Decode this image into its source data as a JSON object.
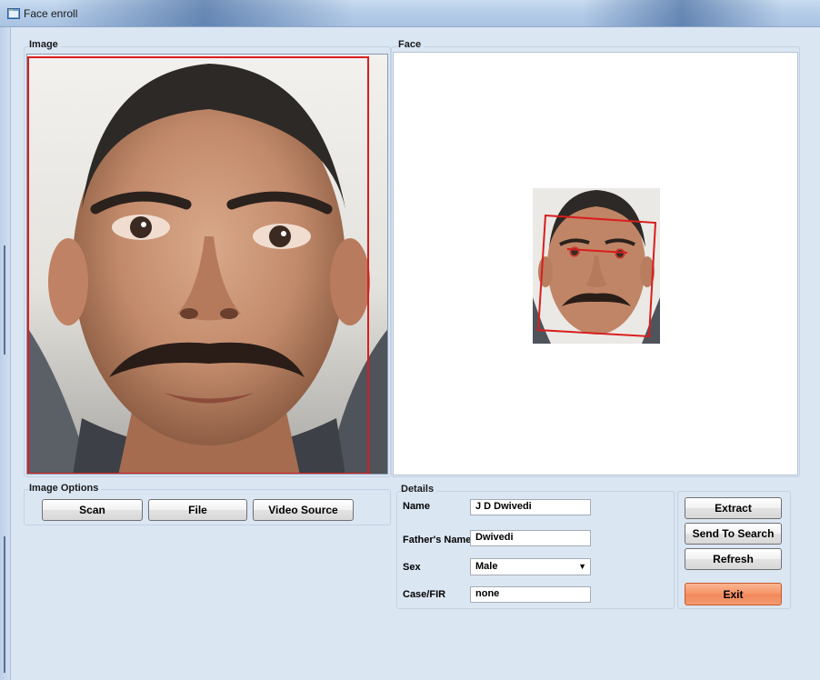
{
  "window": {
    "title": "Face enroll"
  },
  "image_group": {
    "label": "Image"
  },
  "face_group": {
    "label": "Face"
  },
  "image_options": {
    "label": "Image Options",
    "buttons": {
      "scan": "Scan",
      "file": "File",
      "video_source": "Video Source"
    }
  },
  "details": {
    "label": "Details",
    "name_label": "Name",
    "name_value": "J D Dwivedi",
    "father_label": "Father's Name",
    "father_value": "Dwivedi",
    "sex_label": "Sex",
    "sex_value": "Male",
    "case_label": "Case/FIR",
    "case_value": "none"
  },
  "actions": {
    "extract": "Extract",
    "send_to_search": "Send To Search",
    "refresh": "Refresh",
    "exit": "Exit"
  },
  "colors": {
    "detection_box": "#d81e1e",
    "exit_button": "#f59466",
    "background": "#dbe6f3"
  }
}
